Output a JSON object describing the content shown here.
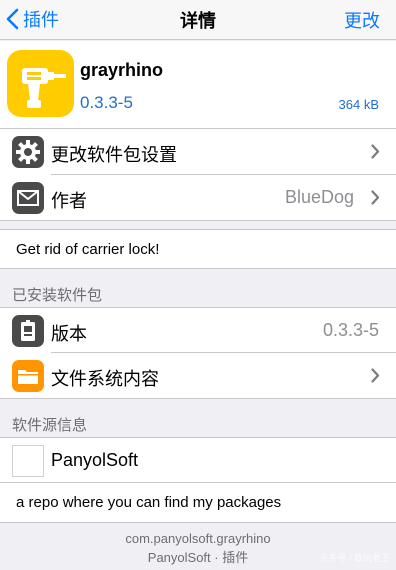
{
  "nav": {
    "back_label": "插件",
    "title": "详情",
    "action_label": "更改"
  },
  "package": {
    "name": "grayrhino",
    "version": "0.3.3-5",
    "size": "364 kB",
    "icon": "drill-icon"
  },
  "actions": [
    {
      "label": "更改软件包设置",
      "icon": "gear-icon"
    },
    {
      "label": "作者",
      "value": "BlueDog",
      "icon": "mail-icon"
    }
  ],
  "description": "Get rid of carrier lock!",
  "installed": {
    "header": "已安装软件包",
    "rows": [
      {
        "label": "版本",
        "value": "0.3.3-5",
        "icon": "package-icon"
      },
      {
        "label": "文件系统内容",
        "icon": "folder-icon"
      }
    ]
  },
  "source": {
    "header": "软件源信息",
    "repo_name": "PanyolSoft",
    "repo_description": "a repo where you can find my packages"
  },
  "footer": {
    "identifier": "com.panyolsoft.grayrhino",
    "attribution": "PanyolSoft · 插件"
  },
  "watermark": "头条号 / 数码老王",
  "colors": {
    "accent": "#0a7aff",
    "icon_yellow": "#ffcc00",
    "icon_orange": "#ff9500",
    "icon_dark": "#4a4a4a"
  }
}
